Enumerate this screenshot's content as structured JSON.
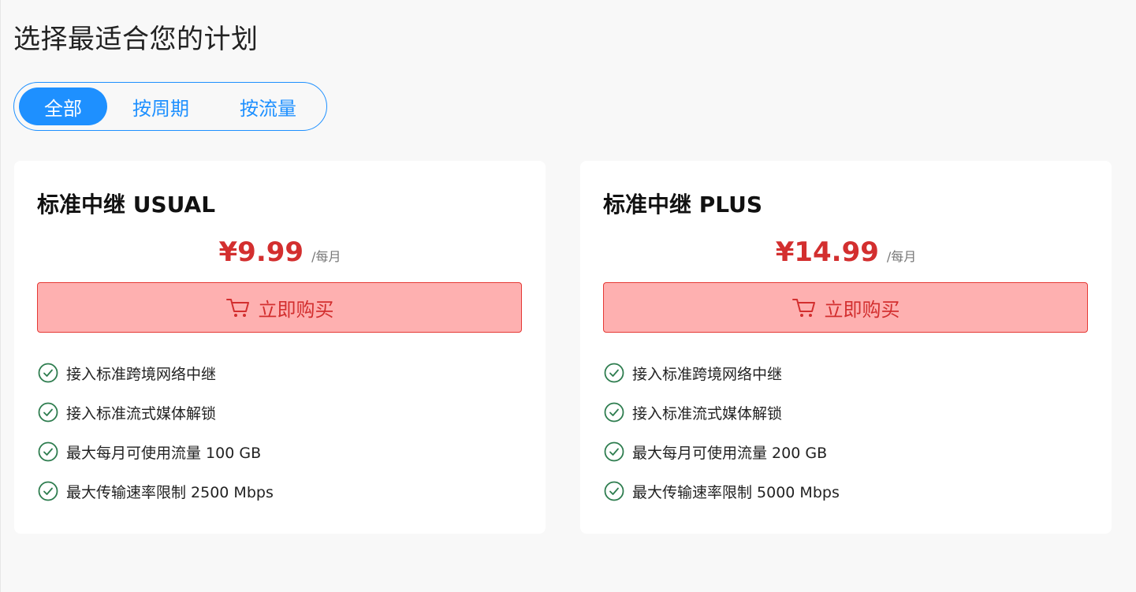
{
  "page": {
    "title": "选择最适合您的计划"
  },
  "tabs": [
    {
      "label": "全部",
      "active": true
    },
    {
      "label": "按周期",
      "active": false
    },
    {
      "label": "按流量",
      "active": false
    }
  ],
  "colors": {
    "accent": "#1e90ff",
    "price": "#d32f2f",
    "buy_bg": "#feb0b0",
    "check": "#2e7d4f"
  },
  "icons": {
    "buy": "cart-icon",
    "feature": "check-circle-icon"
  },
  "plans": [
    {
      "title": "标准中继 USUAL",
      "price": "¥9.99",
      "period": "/每月",
      "buy_label": "立即购买",
      "features": [
        "接入标准跨境网络中继",
        "接入标准流式媒体解锁",
        "最大每月可使用流量 100 GB",
        "最大传输速率限制 2500 Mbps"
      ]
    },
    {
      "title": "标准中继 PLUS",
      "price": "¥14.99",
      "period": "/每月",
      "buy_label": "立即购买",
      "features": [
        "接入标准跨境网络中继",
        "接入标准流式媒体解锁",
        "最大每月可使用流量 200 GB",
        "最大传输速率限制 5000 Mbps"
      ]
    }
  ]
}
